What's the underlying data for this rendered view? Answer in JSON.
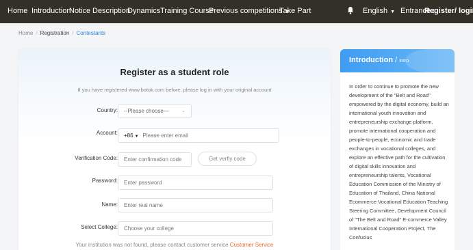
{
  "nav": {
    "items": [
      "Home",
      "Introduction",
      "Notice",
      "Description",
      "Dynamics",
      "Training Course",
      "Previous competitions",
      "Take Part"
    ],
    "language": "English",
    "entrance_label": "Entrance :",
    "register_login": "Register/ login"
  },
  "breadcrumb": [
    "Home",
    "Registration",
    "Contestants"
  ],
  "form": {
    "title": "Register as a student role",
    "subtitle": "If you have registered www.botok.com before, please log in with your original account",
    "country_label": "Country:",
    "country_value": "--Please choose—",
    "account_label": "Account:",
    "phone_prefix": "+86",
    "account_placeholder": "Please enter email",
    "code_label": "Verification Code:",
    "code_placeholder": "Enter confirmation code",
    "code_button": "Get verfiy code",
    "password_label": "Password:",
    "password_placeholder": "Enter password",
    "name_label": "Name:",
    "name_placeholder": "Enter real name",
    "college_label": "Select College:",
    "college_placeholder": "Choose your college",
    "notice": "Your institution was not found, please contact customer service",
    "notice_link": "Customer Service"
  },
  "intro": {
    "title": "Introduction",
    "subtitle": "Intro",
    "body": "In order to continue to promote the new development of the \"Belt and Road\" empowered by the digital economy, build an international youth innovation and entrepreneurship exchange platform, promote international cooperation and people-to-people, economic and trade exchanges in vocational colleges, and explore an effective path for the cultivation of digital skills innovation and entrepreneurship talents, Vocational Education Commission of the Ministry of Education of Thailand, China National Ecommerce Vocational Education Teaching Steering Committee, Development Council of \"The Belt and Road\" E-commerce Valley International Cooperation Project, The Confucius"
  },
  "colors": {
    "nav_bg": "#333028",
    "link_blue": "#2b7fd9",
    "accent_orange": "#e9682b",
    "intro_blue": "#3e9cf2"
  }
}
